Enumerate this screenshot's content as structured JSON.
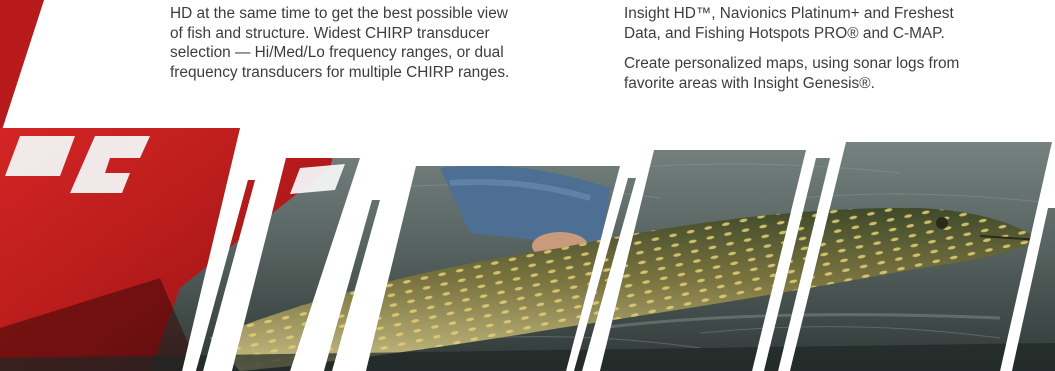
{
  "left_column": {
    "lines": [
      "HD at the same time to get the best possible view",
      "of fish and structure. Widest CHIRP transducer",
      "selection — Hi/Med/Lo frequency ranges, or dual",
      "frequency transducers for multiple CHIRP ranges."
    ]
  },
  "right_column": {
    "para1_lines": [
      "Insight HD™, Navionics Platinum+ and Freshest",
      "Data, and Fishing Hotspots PRO® and C-MAP."
    ],
    "para2_lines": [
      "Create personalized maps, using sonar logs from",
      "favorite areas with Insight Genesis®."
    ]
  },
  "colors": {
    "text": "#3d3d3d",
    "boat_red": "#c21d1d",
    "water": "#5f6b6b",
    "fish_body": "#6f6a3a",
    "sleeve": "#4b6b8c"
  },
  "images": {
    "top_banner_fragment": "red-boat-fragment",
    "photo_strip": "angler-holding-pike-photo"
  }
}
